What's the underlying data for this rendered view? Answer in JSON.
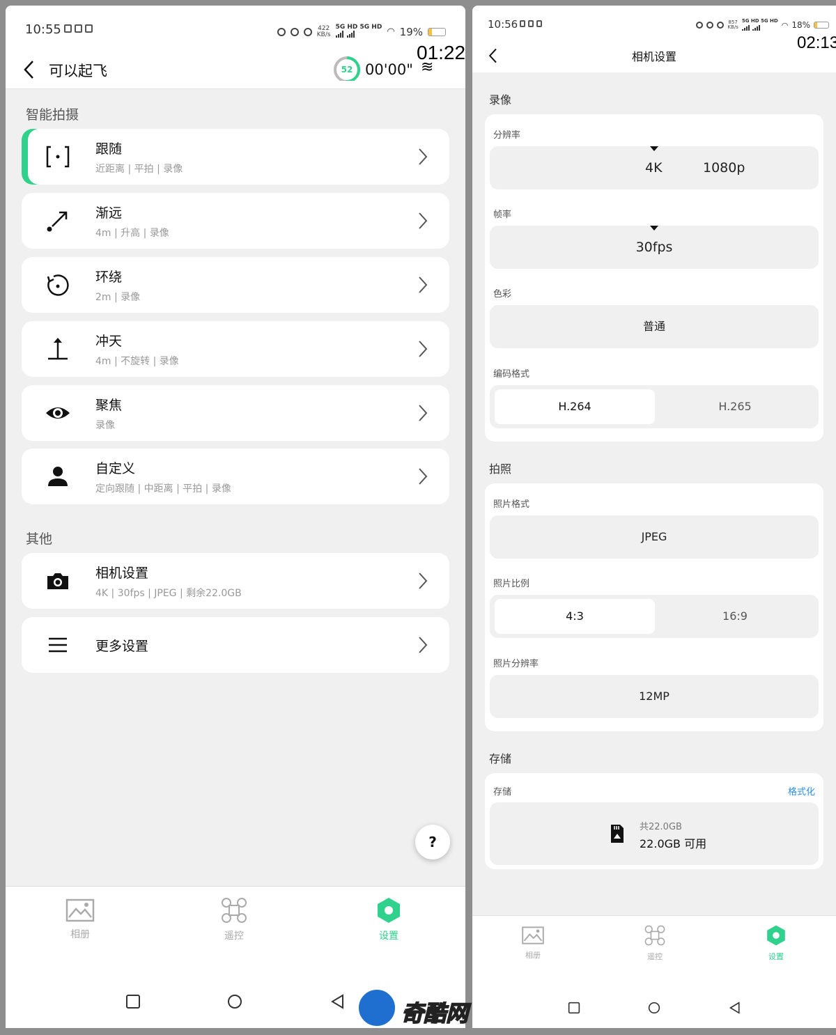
{
  "left": {
    "status": {
      "time": "10:55",
      "kbs_value": "422",
      "kbs_unit": "KB/s",
      "network": "5G HD 5G HD",
      "battery": "19%",
      "battery_level": 0.19
    },
    "header": {
      "title": "可以起飞",
      "battery_ring_value": "52",
      "battery_ring_level": 0.52,
      "timer": "00'00\""
    },
    "overlay_time": "01:22",
    "smart_shoot": {
      "title": "智能拍摄",
      "items": [
        {
          "title": "跟随",
          "subtitle": "近距离 | 平拍 | 录像",
          "icon": "follow-focus-icon"
        },
        {
          "title": "渐远",
          "subtitle": "4m | 升高 | 录像",
          "icon": "diagonal-arrow-icon"
        },
        {
          "title": "环绕",
          "subtitle": "2m | 录像",
          "icon": "orbit-icon"
        },
        {
          "title": "冲天",
          "subtitle": "4m | 不旋转 | 录像",
          "icon": "rocket-up-icon"
        },
        {
          "title": "聚焦",
          "subtitle": "录像",
          "icon": "eye-icon"
        },
        {
          "title": "自定义",
          "subtitle": "定向跟随 | 中距离 | 平拍 | 录像",
          "icon": "person-icon"
        }
      ]
    },
    "other": {
      "title": "其他",
      "items": [
        {
          "title": "相机设置",
          "subtitle": "4K | 30fps | JPEG | 剩余22.0GB",
          "icon": "camera-icon"
        },
        {
          "title": "更多设置",
          "subtitle": "",
          "icon": "menu-icon"
        }
      ]
    },
    "help": "?",
    "nav": {
      "album": "相册",
      "remote": "遥控",
      "settings": "设置"
    }
  },
  "right": {
    "status": {
      "time": "10:56",
      "kbs_value": "857",
      "kbs_unit": "KB/s",
      "network": "5G HD 5G HD",
      "battery": "18%",
      "battery_level": 0.18
    },
    "overlay_time": "02:13",
    "header": {
      "title": "相机设置"
    },
    "video": {
      "title": "录像",
      "resolution": {
        "label": "分辨率",
        "options": [
          "4K",
          "1080p"
        ],
        "selected": "4K"
      },
      "framerate": {
        "label": "帧率",
        "value": "30fps"
      },
      "color": {
        "label": "色彩",
        "value": "普通"
      },
      "codec": {
        "label": "编码格式",
        "options": [
          "H.264",
          "H.265"
        ],
        "selected": "H.264"
      }
    },
    "photo": {
      "title": "拍照",
      "format": {
        "label": "照片格式",
        "value": "JPEG"
      },
      "ratio": {
        "label": "照片比例",
        "options": [
          "4:3",
          "16:9"
        ],
        "selected": "4:3"
      },
      "resolution": {
        "label": "照片分辨率",
        "value": "12MP"
      }
    },
    "storage": {
      "title": "存储",
      "label": "存储",
      "format_link": "格式化",
      "total": "共22.0GB",
      "available": "22.0GB 可用"
    },
    "nav": {
      "album": "相册",
      "remote": "遥控",
      "settings": "设置"
    }
  },
  "watermark": "奇酷网",
  "colors": {
    "accent": "#2fd18c",
    "link": "#2a8de6",
    "background": "#f0f0f0"
  }
}
